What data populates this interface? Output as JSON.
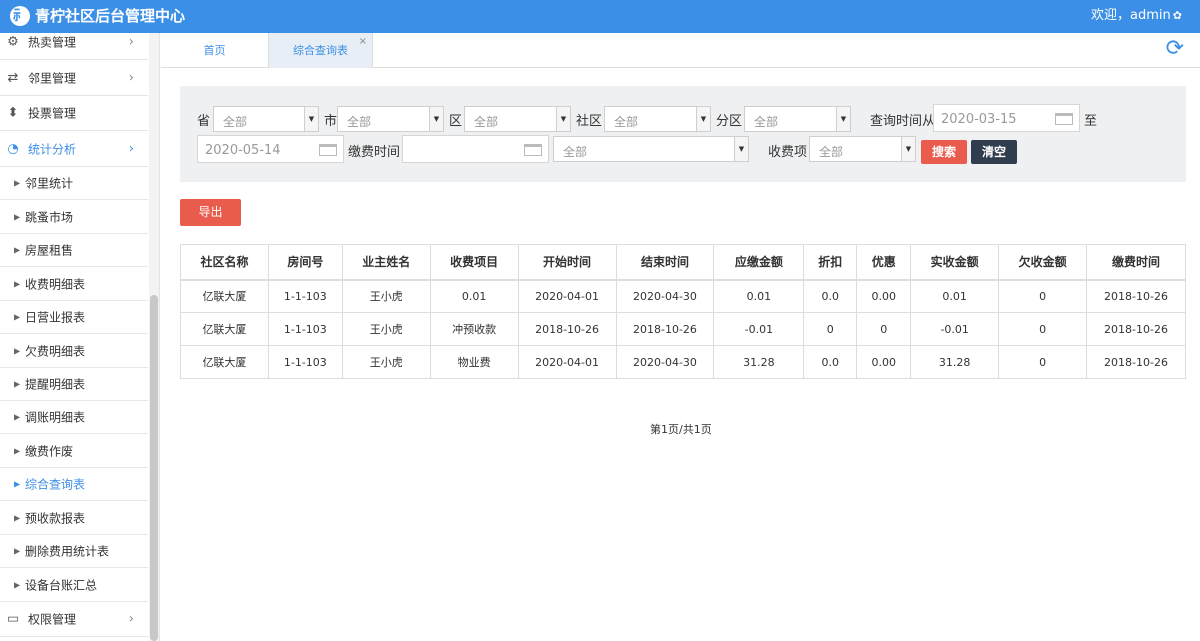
{
  "header": {
    "logo_glyph": "⺬",
    "title": "青柠社区后台管理中心",
    "welcome": "欢迎，admin"
  },
  "sidebar": {
    "items": [
      {
        "label": "热卖管理",
        "icon": "gear-icon"
      },
      {
        "label": "邻里管理",
        "icon": "exchange-icon"
      },
      {
        "label": "投票管理",
        "icon": "sort-icon"
      },
      {
        "label": "统计分析",
        "icon": "pie-chart-icon"
      },
      {
        "label": "权限管理",
        "icon": "monitor-icon"
      }
    ],
    "subitems": [
      "邻里统计",
      "跳蚤市场",
      "房屋租售",
      "收费明细表",
      "日营业报表",
      "欠费明细表",
      "提醒明细表",
      "调账明细表",
      "缴费作废",
      "综合查询表",
      "预收款报表",
      "删除费用统计表",
      "设备台账汇总"
    ],
    "current_subitem": "综合查询表"
  },
  "tabs": {
    "home": "首页",
    "query": "综合查询表",
    "close": "×"
  },
  "filters": {
    "province_label": "省",
    "province_value": "全部",
    "city_label": "市",
    "city_value": "全部",
    "district_label": "区",
    "district_value": "全部",
    "community_label": "社区",
    "community_value": "全部",
    "subdistrict_label": "分区",
    "subdistrict_value": "全部",
    "query_from_label": "查询时间从",
    "query_from_value": "2020-03-15",
    "to_label": "至",
    "query_to_value": "2020-05-14",
    "payment_time_label": "缴费时间",
    "payment_time_value": "",
    "payment_type_value": "全部",
    "fee_item_label": "收费项",
    "fee_item_value": "全部",
    "search_label": "搜索",
    "clear_label": "清空"
  },
  "export_label": "导出",
  "table": {
    "headers": [
      "社区名称",
      "房间号",
      "业主姓名",
      "收费项目",
      "开始时间",
      "结束时间",
      "应缴金额",
      "折扣",
      "优惠",
      "实收金额",
      "欠收金额",
      "缴费时间"
    ],
    "rows": [
      [
        "亿联大厦",
        "1-1-103",
        "王小虎",
        "0.01",
        "2020-04-01",
        "2020-04-30",
        "0.01",
        "0.0",
        "0.00",
        "0.01",
        "0",
        "2018-10-26"
      ],
      [
        "亿联大厦",
        "1-1-103",
        "王小虎",
        "冲预收款",
        "2018-10-26",
        "2018-10-26",
        "-0.01",
        "0",
        "0",
        "-0.01",
        "0",
        "2018-10-26"
      ],
      [
        "亿联大厦",
        "1-1-103",
        "王小虎",
        "物业费",
        "2020-04-01",
        "2020-04-30",
        "31.28",
        "0.0",
        "0.00",
        "31.28",
        "0",
        "2018-10-26"
      ]
    ]
  },
  "pager": "第1页/共1页",
  "colors": {
    "primary": "#3c8fe6",
    "danger": "#e95c4d",
    "dark": "#2f3d4d"
  }
}
